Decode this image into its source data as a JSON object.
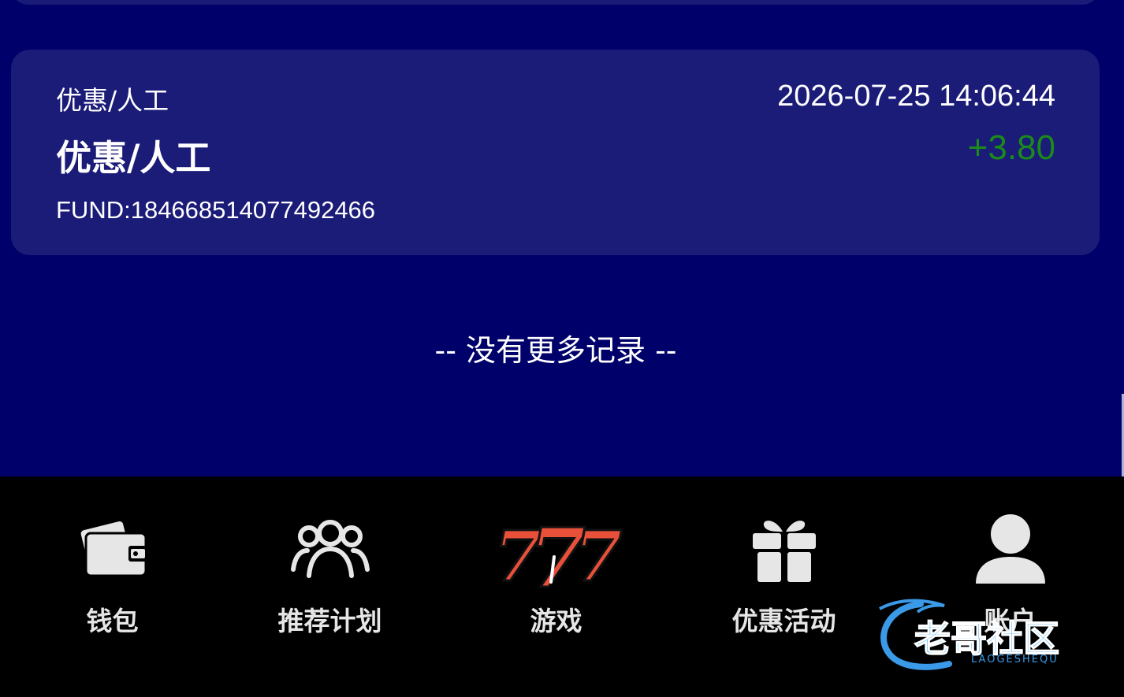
{
  "record": {
    "type": "优惠/人工",
    "datetime": "2026-07-25 14:06:44",
    "title": "优惠/人工",
    "amount": "+3.80",
    "reference": "FUND:184668514077492466"
  },
  "list_end_text": "-- 没有更多记录 --",
  "nav": {
    "items": [
      {
        "label": "钱包",
        "icon": "wallet-icon"
      },
      {
        "label": "推荐计划",
        "icon": "users-icon"
      },
      {
        "label": "游戏",
        "icon": "slot-777-icon"
      },
      {
        "label": "优惠活动",
        "icon": "gift-icon"
      },
      {
        "label": "账户",
        "icon": "user-icon"
      }
    ]
  },
  "watermark": {
    "text": "老哥社区",
    "subtext": "LAOGESHEQU"
  },
  "colors": {
    "background": "#00006b",
    "card": "#1b1b78",
    "amount_positive": "#1a8a1a",
    "nav_background": "#000000",
    "icon": "#e6e6e6",
    "slot_red": "#e8503a"
  }
}
